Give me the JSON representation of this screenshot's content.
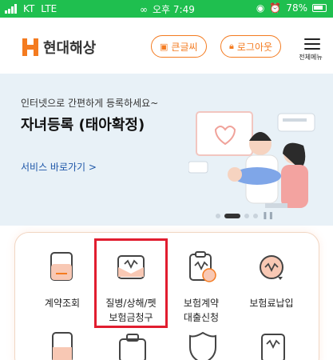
{
  "status_bar": {
    "carrier": "KT",
    "network": "LTE",
    "time": "오후 7:49",
    "battery": "78%"
  },
  "header": {
    "brand": "현대해상",
    "font_size_button": "큰글씨",
    "logout_button": "로그아웃",
    "menu_label": "전체메뉴"
  },
  "banner": {
    "subtitle": "인터넷으로 간편하게 등록하세요~",
    "title": "자녀등록 (태아확정)",
    "link": "서비스 바로가기 >",
    "slides_total": 5,
    "slide_active": 2
  },
  "menu_items": [
    {
      "label": "계약조회",
      "icon": "document-icon"
    },
    {
      "label": "질병/상해/펫\n보험금청구",
      "icon": "claim-envelope-icon"
    },
    {
      "label": "보험계약\n대출신청",
      "icon": "loan-clipboard-icon"
    },
    {
      "label": "보험료납입",
      "icon": "payment-icon"
    }
  ],
  "colors": {
    "accent": "#f47b20",
    "status_bar": "#1fbf4f",
    "banner_bg": "#e8f1f7",
    "highlight_box": "#e11d2f"
  }
}
